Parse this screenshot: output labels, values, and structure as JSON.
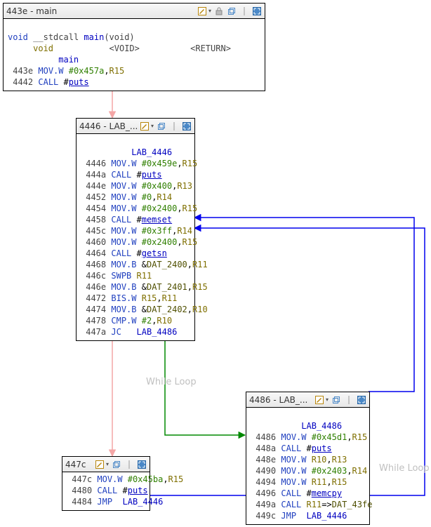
{
  "blocks": {
    "b1": {
      "title": "443e - main",
      "sig_ret": "void",
      "sig_cc": "__stdcall",
      "sig_name": "main",
      "sig_args": "(void)",
      "row_void": "void",
      "row_void_tag": "<VOID>",
      "row_return_tag": "<RETURN>",
      "row_main": "main",
      "lines": [
        {
          "addr": "443e",
          "mn": "MOV.W",
          "rest": [
            {
              "t": "imm",
              "v": "#0x457a"
            },
            {
              "t": "op",
              "v": ","
            },
            {
              "t": "reg",
              "v": "R15"
            }
          ]
        },
        {
          "addr": "4442",
          "mn": "CALL",
          "rest": [
            {
              "t": "op",
              "v": " #"
            },
            {
              "t": "func",
              "v": "puts"
            }
          ]
        }
      ]
    },
    "b2": {
      "title": "4446 - LAB_...",
      "label": "LAB_4446",
      "lines": [
        {
          "addr": "4446",
          "mn": "MOV.W",
          "rest": [
            {
              "t": "imm",
              "v": "#0x459e"
            },
            {
              "t": "op",
              "v": ","
            },
            {
              "t": "reg",
              "v": "R15"
            }
          ]
        },
        {
          "addr": "444a",
          "mn": "CALL",
          "rest": [
            {
              "t": "op",
              "v": " #"
            },
            {
              "t": "func",
              "v": "puts"
            }
          ]
        },
        {
          "addr": "444e",
          "mn": "MOV.W",
          "rest": [
            {
              "t": "imm",
              "v": "#0x400"
            },
            {
              "t": "op",
              "v": ","
            },
            {
              "t": "reg",
              "v": "R13"
            }
          ]
        },
        {
          "addr": "4452",
          "mn": "MOV.W",
          "rest": [
            {
              "t": "imm",
              "v": "#0"
            },
            {
              "t": "op",
              "v": ","
            },
            {
              "t": "reg",
              "v": "R14"
            }
          ]
        },
        {
          "addr": "4454",
          "mn": "MOV.W",
          "rest": [
            {
              "t": "imm",
              "v": "#0x2400"
            },
            {
              "t": "op",
              "v": ","
            },
            {
              "t": "reg",
              "v": "R15"
            }
          ]
        },
        {
          "addr": "4458",
          "mn": "CALL",
          "rest": [
            {
              "t": "op",
              "v": " #"
            },
            {
              "t": "func",
              "v": "memset"
            }
          ]
        },
        {
          "addr": "445c",
          "mn": "MOV.W",
          "rest": [
            {
              "t": "imm",
              "v": "#0x3ff"
            },
            {
              "t": "op",
              "v": ","
            },
            {
              "t": "reg",
              "v": "R14"
            }
          ]
        },
        {
          "addr": "4460",
          "mn": "MOV.W",
          "rest": [
            {
              "t": "imm",
              "v": "#0x2400"
            },
            {
              "t": "op",
              "v": ","
            },
            {
              "t": "reg",
              "v": "R15"
            }
          ]
        },
        {
          "addr": "4464",
          "mn": "CALL",
          "rest": [
            {
              "t": "op",
              "v": " #"
            },
            {
              "t": "func",
              "v": "getsn"
            }
          ]
        },
        {
          "addr": "4468",
          "mn": "MOV.B",
          "rest": [
            {
              "t": "op",
              "v": "&"
            },
            {
              "t": "dat",
              "v": "DAT_2400"
            },
            {
              "t": "op",
              "v": ","
            },
            {
              "t": "reg",
              "v": "R11"
            }
          ]
        },
        {
          "addr": "446c",
          "mn": "SWPB",
          "rest": [
            {
              "t": "op",
              "v": " "
            },
            {
              "t": "reg",
              "v": "R11"
            }
          ]
        },
        {
          "addr": "446e",
          "mn": "MOV.B",
          "rest": [
            {
              "t": "op",
              "v": "&"
            },
            {
              "t": "dat",
              "v": "DAT_2401"
            },
            {
              "t": "op",
              "v": ","
            },
            {
              "t": "reg",
              "v": "R15"
            }
          ]
        },
        {
          "addr": "4472",
          "mn": "BIS.W",
          "rest": [
            {
              "t": "reg",
              "v": "R15"
            },
            {
              "t": "op",
              "v": ","
            },
            {
              "t": "reg",
              "v": "R11"
            }
          ]
        },
        {
          "addr": "4474",
          "mn": "MOV.B",
          "rest": [
            {
              "t": "op",
              "v": "&"
            },
            {
              "t": "dat",
              "v": "DAT_2402"
            },
            {
              "t": "op",
              "v": ","
            },
            {
              "t": "reg",
              "v": "R10"
            }
          ]
        },
        {
          "addr": "4478",
          "mn": "CMP.W",
          "rest": [
            {
              "t": "imm",
              "v": "#2"
            },
            {
              "t": "op",
              "v": ","
            },
            {
              "t": "reg",
              "v": "R10"
            }
          ]
        },
        {
          "addr": "447a",
          "mn": "JC",
          "rest": [
            {
              "t": "op",
              "v": "   "
            },
            {
              "t": "lab",
              "v": "LAB_4486"
            }
          ]
        }
      ]
    },
    "b3": {
      "title": "4486 - LAB_...",
      "label": "LAB_4486",
      "lines": [
        {
          "addr": "4486",
          "mn": "MOV.W",
          "rest": [
            {
              "t": "imm",
              "v": "#0x45d1"
            },
            {
              "t": "op",
              "v": ","
            },
            {
              "t": "reg",
              "v": "R15"
            }
          ]
        },
        {
          "addr": "448a",
          "mn": "CALL",
          "rest": [
            {
              "t": "op",
              "v": " #"
            },
            {
              "t": "func",
              "v": "puts"
            }
          ]
        },
        {
          "addr": "448e",
          "mn": "MOV.W",
          "rest": [
            {
              "t": "reg",
              "v": "R10"
            },
            {
              "t": "op",
              "v": ","
            },
            {
              "t": "reg",
              "v": "R13"
            }
          ]
        },
        {
          "addr": "4490",
          "mn": "MOV.W",
          "rest": [
            {
              "t": "imm",
              "v": "#0x2403"
            },
            {
              "t": "op",
              "v": ","
            },
            {
              "t": "reg",
              "v": "R14"
            }
          ]
        },
        {
          "addr": "4494",
          "mn": "MOV.W",
          "rest": [
            {
              "t": "reg",
              "v": "R11"
            },
            {
              "t": "op",
              "v": ","
            },
            {
              "t": "reg",
              "v": "R15"
            }
          ]
        },
        {
          "addr": "4496",
          "mn": "CALL",
          "rest": [
            {
              "t": "op",
              "v": " #"
            },
            {
              "t": "func",
              "v": "memcpy"
            }
          ]
        },
        {
          "addr": "449a",
          "mn": "CALL",
          "rest": [
            {
              "t": "op",
              "v": " "
            },
            {
              "t": "reg",
              "v": "R11"
            },
            {
              "t": "op",
              "v": "=>"
            },
            {
              "t": "dat",
              "v": "DAT_43fe"
            }
          ]
        },
        {
          "addr": "449c",
          "mn": "JMP",
          "rest": [
            {
              "t": "op",
              "v": "  "
            },
            {
              "t": "lab",
              "v": "LAB_4446"
            }
          ]
        }
      ]
    },
    "b4": {
      "title": "447c",
      "lines": [
        {
          "addr": "447c",
          "mn": "MOV.W",
          "rest": [
            {
              "t": "imm",
              "v": "#0x45ba"
            },
            {
              "t": "op",
              "v": ","
            },
            {
              "t": "reg",
              "v": "R15"
            }
          ]
        },
        {
          "addr": "4480",
          "mn": "CALL",
          "rest": [
            {
              "t": "op",
              "v": " #"
            },
            {
              "t": "func",
              "v": "puts"
            }
          ]
        },
        {
          "addr": "4484",
          "mn": "JMP",
          "rest": [
            {
              "t": "op",
              "v": "  "
            },
            {
              "t": "lab",
              "v": "LAB_4446"
            }
          ]
        }
      ]
    }
  },
  "annotations": {
    "while1": "While Loop",
    "while2": "While Loop"
  },
  "icons": {
    "edit": "edit-icon",
    "lock": "lock-icon",
    "restore": "restore-icon",
    "divider": "divider-icon",
    "expand": "expand-icon"
  }
}
